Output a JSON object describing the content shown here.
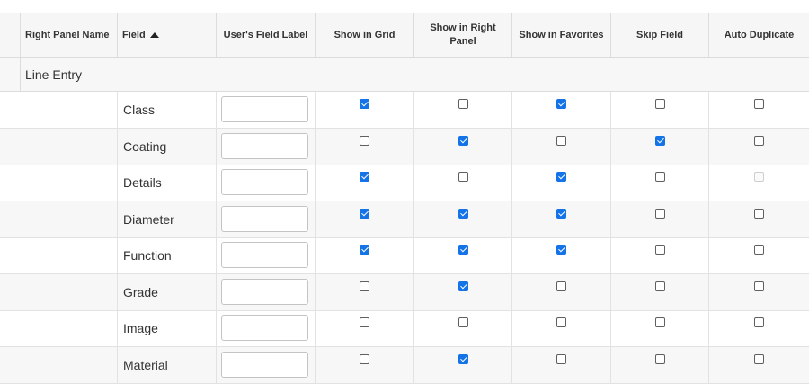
{
  "columns": {
    "right_panel_name": "Right Panel Name",
    "field": "Field",
    "users_field_label": "User's Field Label",
    "show_in_grid": "Show in Grid",
    "show_in_right_panel": "Show in Right Panel",
    "show_in_favorites": "Show in Favorites",
    "skip_field": "Skip Field",
    "auto_duplicate": "Auto Duplicate"
  },
  "sort": {
    "column": "field",
    "direction": "ascending",
    "icon": "sort-up-icon"
  },
  "group": {
    "label": "Line Entry"
  },
  "checkbox_color": "#1473e6",
  "rows": [
    {
      "field": "Class",
      "label_value": "",
      "show_in_grid": true,
      "show_in_right_panel": false,
      "show_in_favorites": true,
      "skip_field": false,
      "auto_duplicate": false,
      "auto_duplicate_disabled": false
    },
    {
      "field": "Coating",
      "label_value": "",
      "show_in_grid": false,
      "show_in_right_panel": true,
      "show_in_favorites": false,
      "skip_field": true,
      "auto_duplicate": false,
      "auto_duplicate_disabled": false
    },
    {
      "field": "Details",
      "label_value": "",
      "show_in_grid": true,
      "show_in_right_panel": false,
      "show_in_favorites": true,
      "skip_field": false,
      "auto_duplicate": false,
      "auto_duplicate_disabled": true
    },
    {
      "field": "Diameter",
      "label_value": "",
      "show_in_grid": true,
      "show_in_right_panel": true,
      "show_in_favorites": true,
      "skip_field": false,
      "auto_duplicate": false,
      "auto_duplicate_disabled": false
    },
    {
      "field": "Function",
      "label_value": "",
      "show_in_grid": true,
      "show_in_right_panel": true,
      "show_in_favorites": true,
      "skip_field": false,
      "auto_duplicate": false,
      "auto_duplicate_disabled": false
    },
    {
      "field": "Grade",
      "label_value": "",
      "show_in_grid": false,
      "show_in_right_panel": true,
      "show_in_favorites": false,
      "skip_field": false,
      "auto_duplicate": false,
      "auto_duplicate_disabled": false
    },
    {
      "field": "Image",
      "label_value": "",
      "show_in_grid": false,
      "show_in_right_panel": false,
      "show_in_favorites": false,
      "skip_field": false,
      "auto_duplicate": false,
      "auto_duplicate_disabled": false
    },
    {
      "field": "Material",
      "label_value": "",
      "show_in_grid": false,
      "show_in_right_panel": true,
      "show_in_favorites": false,
      "skip_field": false,
      "auto_duplicate": false,
      "auto_duplicate_disabled": false
    }
  ]
}
